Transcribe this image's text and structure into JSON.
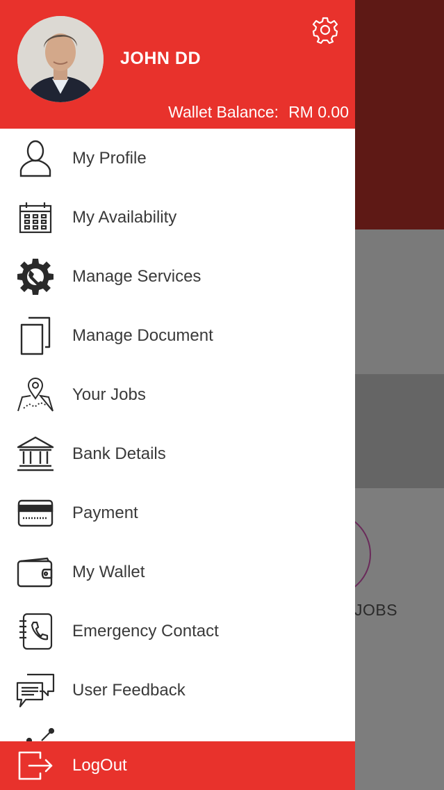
{
  "header": {
    "user_name": "JOHN DD",
    "wallet_label": "Wallet Balance:",
    "wallet_amount": "RM 0.00"
  },
  "menu": {
    "items": [
      {
        "label": "My Profile",
        "icon": "user-icon"
      },
      {
        "label": "My Availability",
        "icon": "calendar-icon"
      },
      {
        "label": "Manage Services",
        "icon": "gear-wrench-icon"
      },
      {
        "label": "Manage Document",
        "icon": "documents-icon"
      },
      {
        "label": "Your Jobs",
        "icon": "map-pin-icon"
      },
      {
        "label": "Bank Details",
        "icon": "bank-icon"
      },
      {
        "label": "Payment",
        "icon": "credit-card-icon"
      },
      {
        "label": "My Wallet",
        "icon": "wallet-icon"
      },
      {
        "label": "Emergency Contact",
        "icon": "phone-book-icon"
      },
      {
        "label": "User Feedback",
        "icon": "chat-bubbles-icon"
      }
    ],
    "logout_label": "LogOut"
  },
  "background": {
    "jobs_label": "JOBS"
  },
  "colors": {
    "accent": "#e8322c",
    "dark_red": "#5e1915",
    "text": "#3a3a3a"
  }
}
